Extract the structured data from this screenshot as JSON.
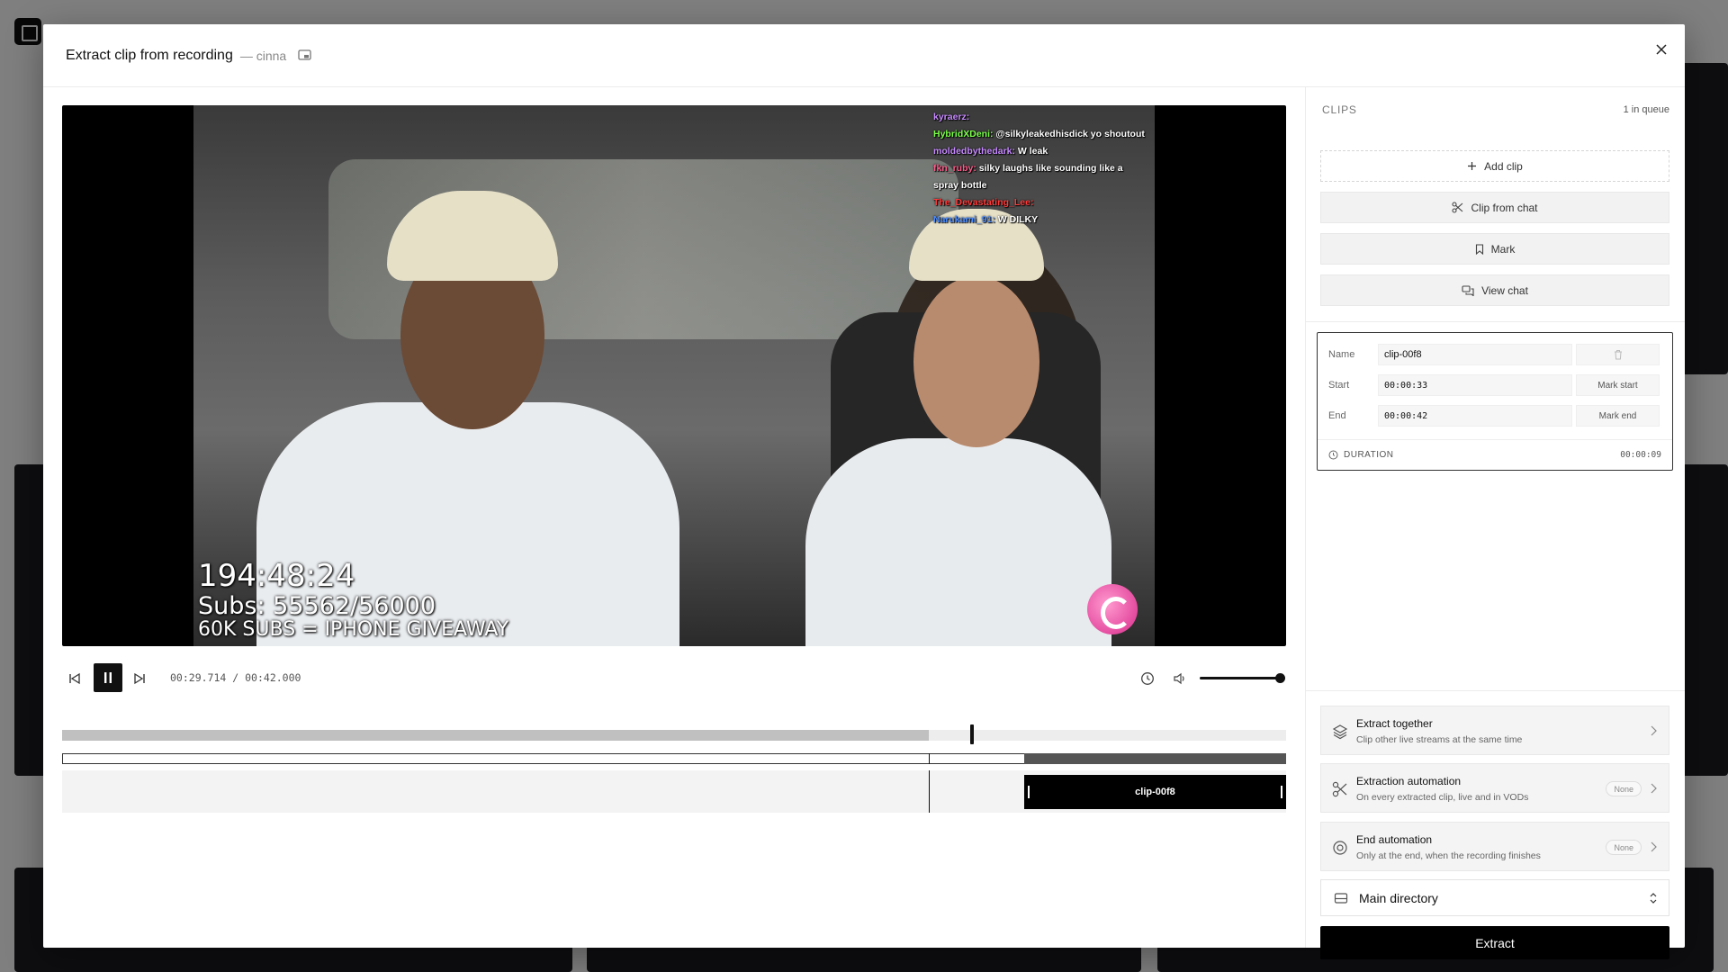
{
  "modal": {
    "title": "Extract clip from recording",
    "subtitle": "— cinna"
  },
  "video": {
    "overlay_time": "194:48:24",
    "overlay_subs": "Subs: 55562/56000",
    "overlay_giveaway": "60K SUBS = IPHONE GIVEAWAY",
    "chat": [
      {
        "user": "kyraerz:",
        "user_color": "#c78bff",
        "text": ""
      },
      {
        "user": "HybridXDeni:",
        "user_color": "#7cff4a",
        "text": "@silkyleakedhisdick yo shoutout"
      },
      {
        "user": "moldedbythedark:",
        "user_color": "#c78bff",
        "text": "W leak"
      },
      {
        "user": "fkn_ruby:",
        "user_color": "#ff5b8a",
        "text": "silky laughs like sounding like a spray bottle"
      },
      {
        "user": "The_Devastating_Lee:",
        "user_color": "#ff3b3b",
        "text": ""
      },
      {
        "user": "Narukami_91:",
        "user_color": "#4a8bff",
        "text": "W DILKY"
      }
    ]
  },
  "player": {
    "current_time": "00:29.714",
    "separator": "/",
    "total_time": "00:42.000",
    "volume": 1.0,
    "progress_fraction": 0.708
  },
  "timeline": {
    "overview_window_start": 0.786,
    "playhead_fraction": 0.708,
    "clip_start_fraction": 0.786,
    "clip_end_fraction": 1.0,
    "clip_label": "clip-00f8"
  },
  "panel": {
    "title": "CLIPS",
    "queue": "1 in queue",
    "buttons": {
      "add_clip": "Add clip",
      "clip_from_chat": "Clip from chat",
      "mark": "Mark",
      "view_chat": "View chat"
    },
    "editor": {
      "name_label": "Name",
      "name_value": "clip-00f8",
      "start_label": "Start",
      "start_value": "00:00:33",
      "mark_start": "Mark start",
      "end_label": "End",
      "end_value": "00:00:42",
      "mark_end": "Mark end",
      "duration_label": "DURATION",
      "duration_value": "00:00:09"
    },
    "automations": [
      {
        "title": "Extract together",
        "desc": "Clip other live streams at the same time",
        "badge": ""
      },
      {
        "title": "Extraction automation",
        "desc": "On every extracted clip, live and in VODs",
        "badge": "None"
      },
      {
        "title": "End automation",
        "desc": "Only at the end, when the recording finishes",
        "badge": "None"
      }
    ],
    "directory": "Main directory",
    "extract": "Extract"
  }
}
